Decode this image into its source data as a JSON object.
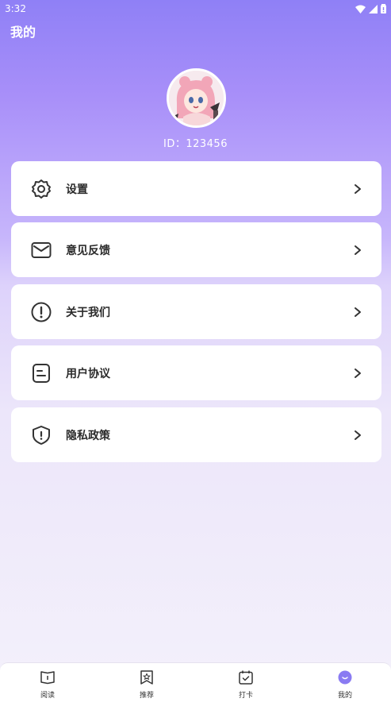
{
  "status_bar": {
    "time": "3:32"
  },
  "header": {
    "title": "我的"
  },
  "profile": {
    "id_text": "ID：123456"
  },
  "menu": {
    "items": [
      {
        "label": "设置",
        "icon": "gear-icon"
      },
      {
        "label": "意见反馈",
        "icon": "mail-icon"
      },
      {
        "label": "关于我们",
        "icon": "alert-circle-icon"
      },
      {
        "label": "用户协议",
        "icon": "document-icon"
      },
      {
        "label": "隐私政策",
        "icon": "shield-icon"
      }
    ]
  },
  "tabbar": {
    "items": [
      {
        "label": "阅读",
        "icon": "book-icon",
        "active": false
      },
      {
        "label": "推荐",
        "icon": "star-bookmark-icon",
        "active": false
      },
      {
        "label": "打卡",
        "icon": "calendar-check-icon",
        "active": false
      },
      {
        "label": "我的",
        "icon": "profile-icon",
        "active": true
      }
    ]
  },
  "colors": {
    "accent": "#8f80f6",
    "icon_dark": "#333333",
    "active_tab": "#8a7bf2"
  }
}
